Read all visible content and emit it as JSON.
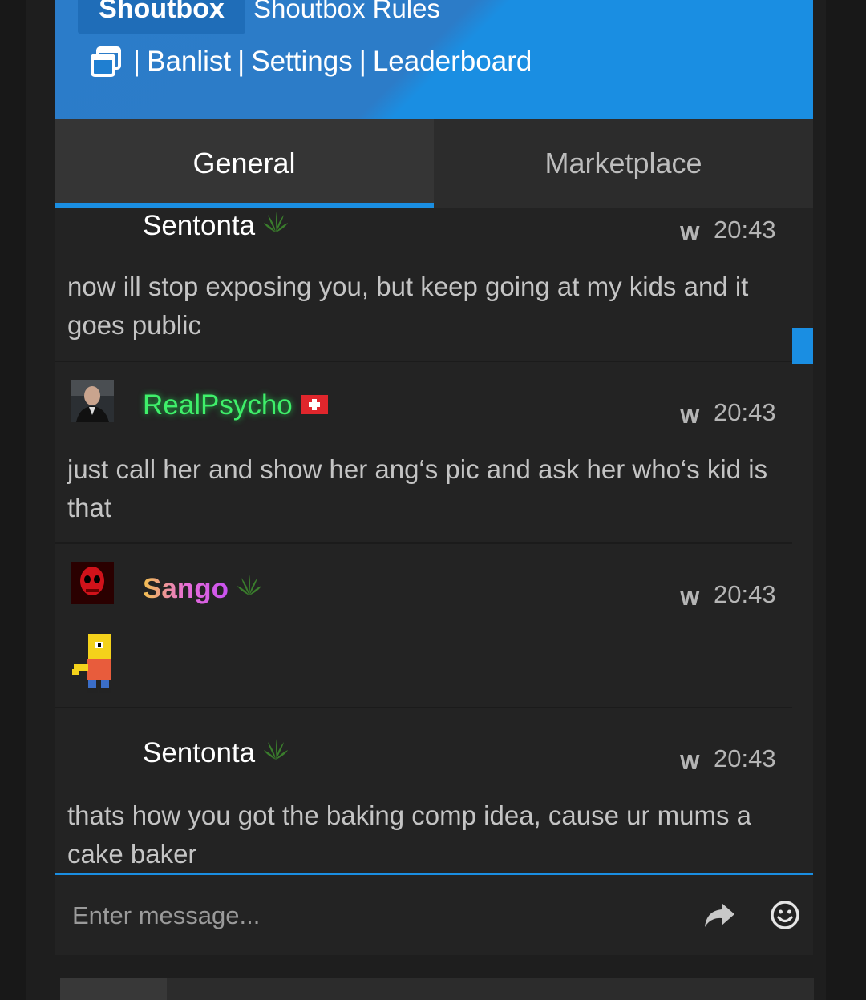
{
  "header": {
    "brand": "Shoutbox",
    "rules": "Shoutbox Rules",
    "links": [
      "Banlist",
      "Settings",
      "Leaderboard"
    ],
    "separator": "|"
  },
  "tabs": [
    {
      "label": "General",
      "active": true
    },
    {
      "label": "Marketplace",
      "active": false
    }
  ],
  "messages": [
    {
      "user": "Sentonta",
      "badge": "leaf-icon",
      "whisper": "W",
      "time": "20:43",
      "text": "now ill stop exposing you, but keep going at my kids and it goes public",
      "name_color": "#ffffff"
    },
    {
      "user": "RealPsycho",
      "badge": "swiss-flag-icon",
      "whisper": "W",
      "time": "20:43",
      "text": "just call her and show her ang‘s pic and ask her who‘s kid is that",
      "name_color": "#3ff06a"
    },
    {
      "user": "Sango",
      "badge": "leaf-icon",
      "whisper": "W",
      "time": "20:43",
      "text": "",
      "name_color": "#e8a0f0"
    },
    {
      "user": "Sentonta",
      "badge": "leaf-icon",
      "whisper": "W",
      "time": "20:43",
      "text": "thats how you got the baking comp idea, cause ur mums a cake baker",
      "name_color": "#ffffff"
    }
  ],
  "input": {
    "placeholder": "Enter message..."
  },
  "colors": {
    "accent": "#1a8ee2",
    "header": "#2b7cc9"
  }
}
